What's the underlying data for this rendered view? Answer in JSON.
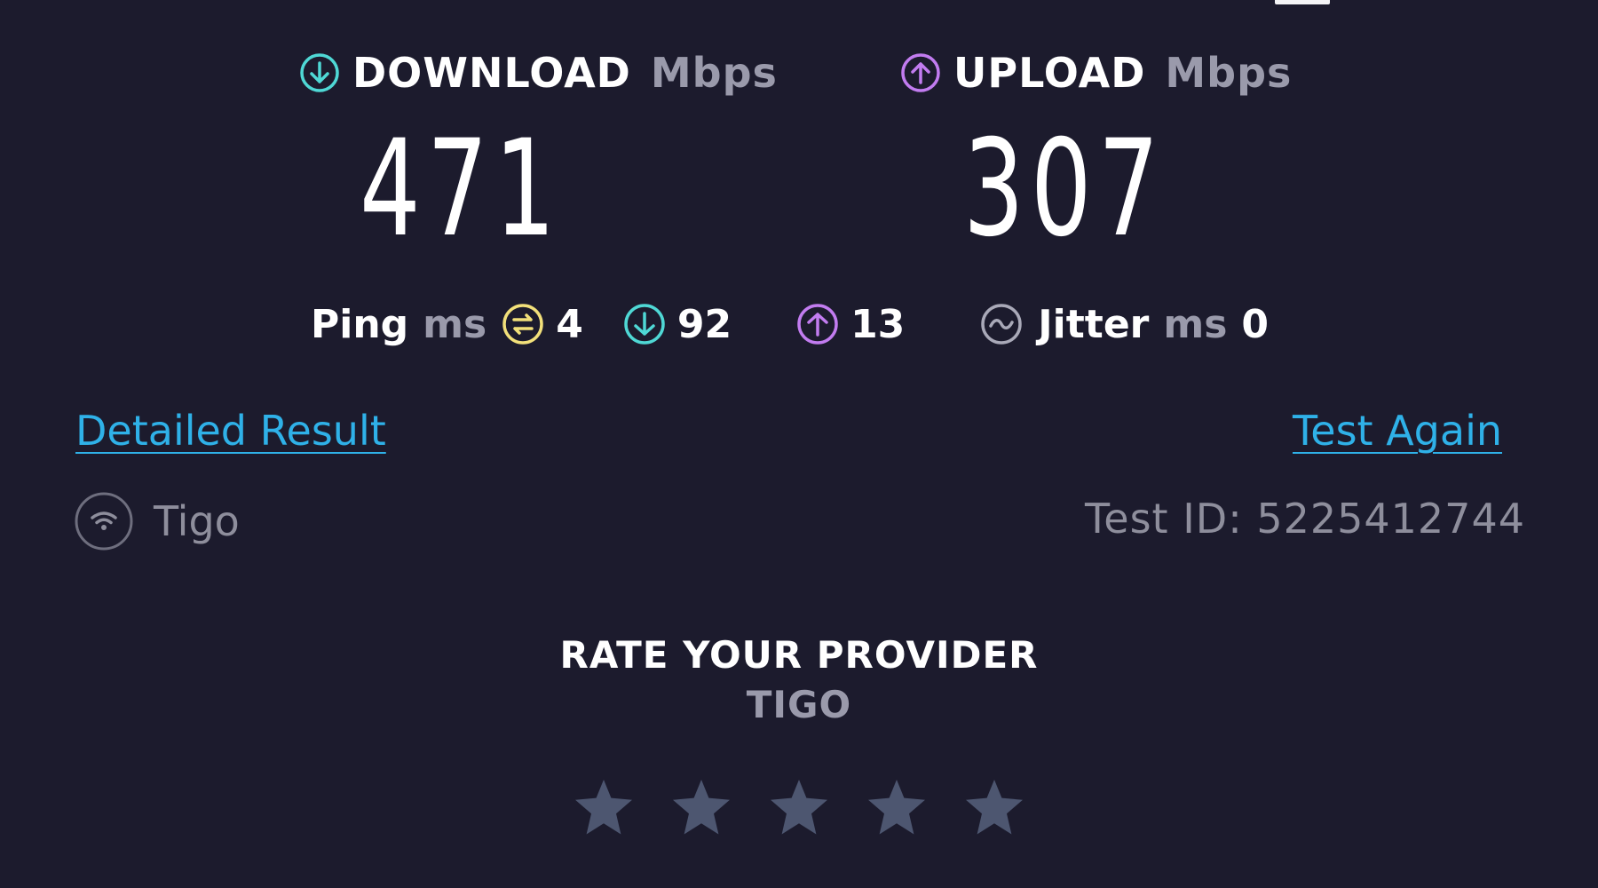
{
  "download": {
    "label": "DOWNLOAD",
    "unit": "Mbps",
    "value": "471",
    "icon": "arrow-down-circle-icon",
    "color": "#4fd8d5"
  },
  "upload": {
    "label": "UPLOAD",
    "unit": "Mbps",
    "value": "307",
    "icon": "arrow-up-circle-icon",
    "color": "#c27cf0"
  },
  "ping": {
    "label": "Ping",
    "unit": "ms",
    "idle_value": "4",
    "idle_icon": "ping-idle-icon",
    "idle_color": "#f2e07a",
    "download_value": "92",
    "download_icon": "arrow-down-circle-icon",
    "upload_value": "13",
    "upload_icon": "arrow-up-circle-icon"
  },
  "jitter": {
    "label": "Jitter",
    "unit": "ms",
    "value": "0",
    "icon": "jitter-wave-icon"
  },
  "links": {
    "detailed_result": "Detailed Result",
    "test_again": "Test Again",
    "color": "#2fb1e8"
  },
  "provider": {
    "name": "Tigo",
    "icon": "wifi-icon",
    "test_id": "Test ID: 5225412744"
  },
  "rating": {
    "title": "RATE YOUR PROVIDER",
    "provider": "TIGO",
    "stars_count": 5,
    "star_color": "#4d5670"
  }
}
